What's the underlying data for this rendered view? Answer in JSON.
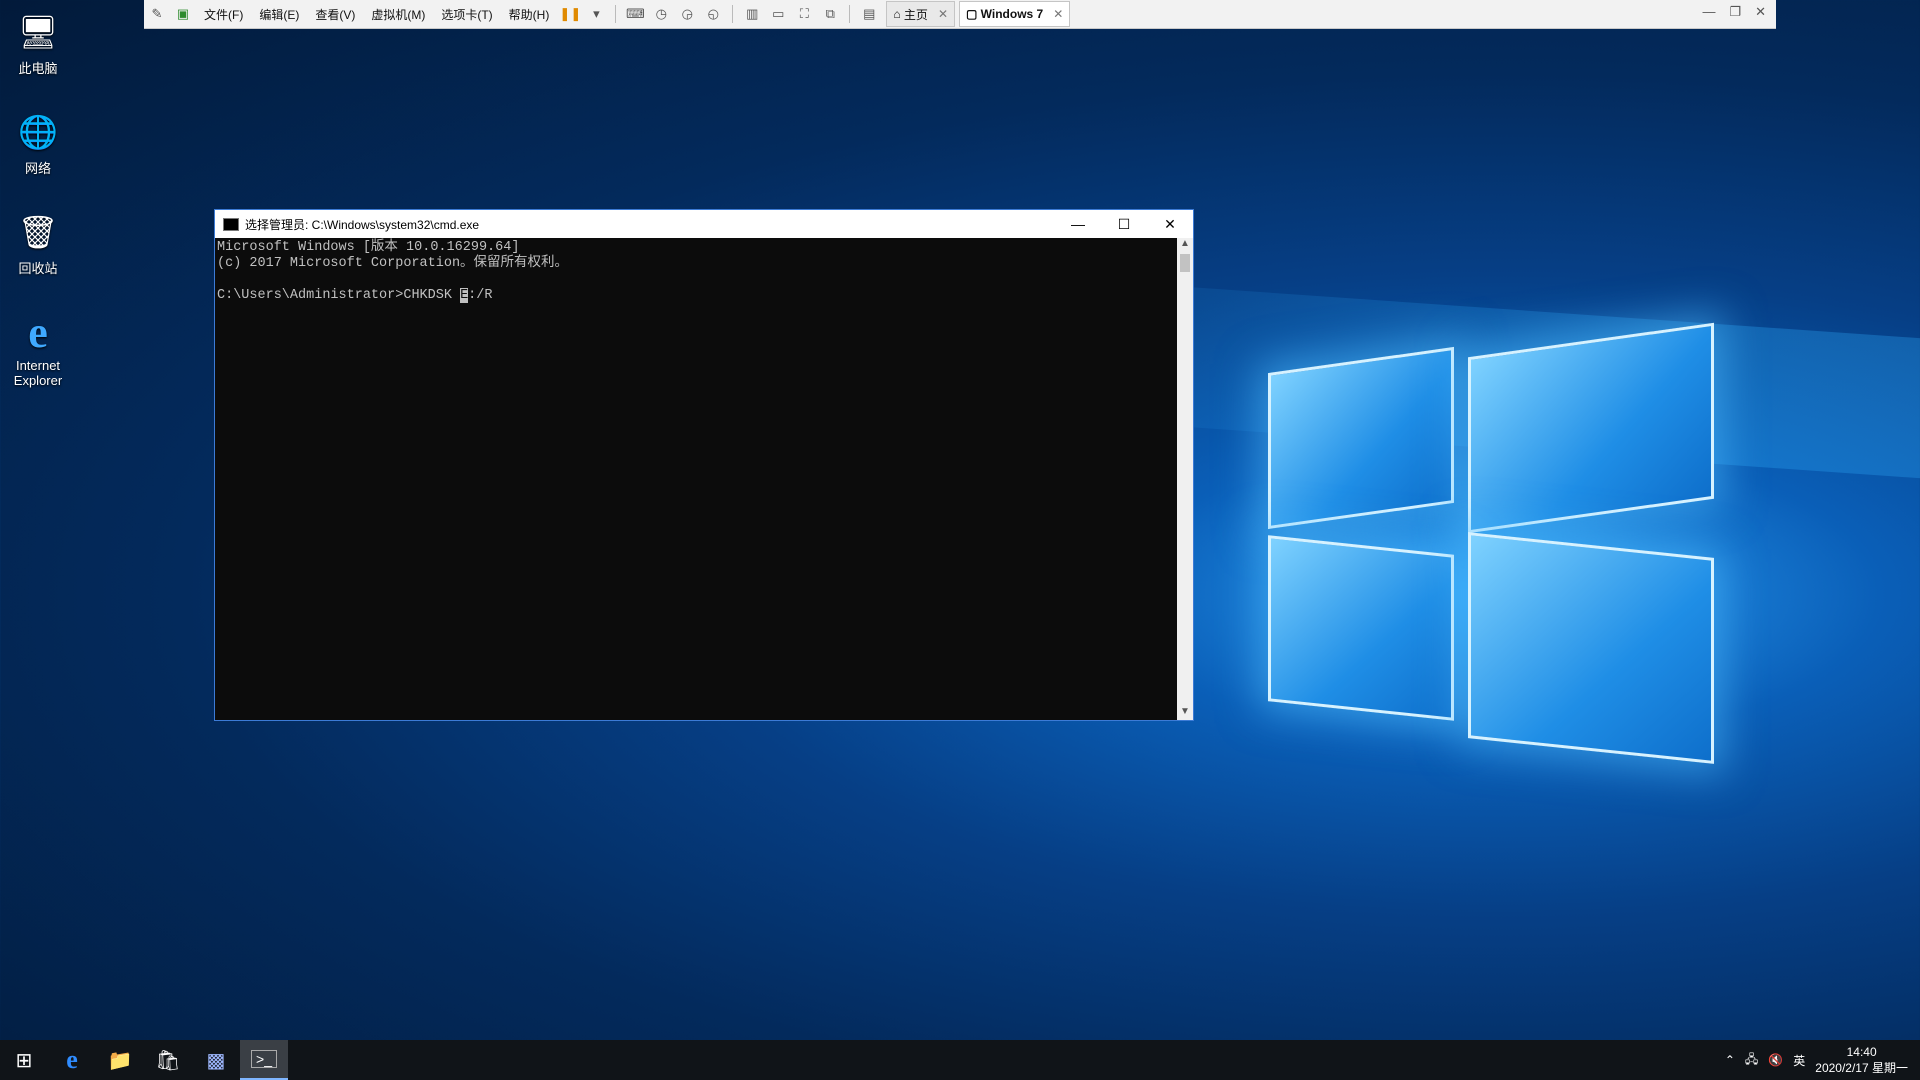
{
  "vmware": {
    "menus": [
      "文件(F)",
      "编辑(E)",
      "查看(V)",
      "虚拟机(M)",
      "选项卡(T)",
      "帮助(H)"
    ],
    "tabs": [
      {
        "label": "主页",
        "icon": "home-icon"
      },
      {
        "label": "Windows 7",
        "icon": "vm-icon"
      }
    ]
  },
  "desktop": {
    "icons": [
      {
        "label": "此电脑",
        "icon": "computer-icon"
      },
      {
        "label": "网络",
        "icon": "network-icon"
      },
      {
        "label": "回收站",
        "icon": "recycle-bin-icon"
      },
      {
        "label": "Internet Explorer",
        "icon": "ie-icon"
      }
    ]
  },
  "cmd": {
    "title": "选择管理员: C:\\Windows\\system32\\cmd.exe",
    "line1": "Microsoft Windows [版本 10.0.16299.64]",
    "line2": "(c) 2017 Microsoft Corporation。保留所有权利。",
    "prompt": "C:\\Users\\Administrator>",
    "command_before": "CHKDSK ",
    "command_selected": "E",
    "command_after": ":/R"
  },
  "taskbar": {
    "items": [
      "start-icon",
      "edge-icon",
      "file-explorer-icon",
      "store-icon",
      "vmware-icon",
      "cmd-icon"
    ],
    "ime": "英",
    "time": "14:40",
    "date": "2020/2/17 星期一"
  }
}
